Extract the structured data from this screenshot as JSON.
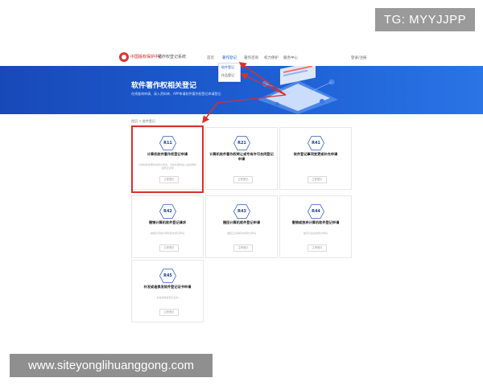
{
  "watermark": {
    "tg": "TG: MYYJJPP",
    "site": "www.siteyonglihuanggong.com"
  },
  "header": {
    "logo_text": "中国版权保护中心",
    "logo_sub": "著作权登记系统",
    "nav": [
      "首页",
      "著作登记",
      "著作咨询",
      "权力保护",
      "服务中心"
    ],
    "active_nav_index": 1,
    "login": "登录/注册",
    "dropdown": [
      "软件登记",
      "作品登记"
    ]
  },
  "hero": {
    "title": "软件著作权相关登记",
    "subtitle": "在线查询申请、录入资料单、APP申请软件著作权登记申请登记"
  },
  "breadcrumb": "首页 > 软件登记",
  "cards": [
    {
      "code": "R11",
      "title": "计算机软件著作权登记申请",
      "desc": "计算机软件著作权登记申请、为软件著作权人提供著作权登记证明",
      "button": "立即登记"
    },
    {
      "code": "R21",
      "title": "计算机软件著作权转让或专有许可合同登记申请",
      "desc": "",
      "button": "立即登记"
    },
    {
      "code": "R41",
      "title": "软件登记事项变更或补充申请",
      "desc": "",
      "button": "立即登记"
    },
    {
      "code": "R42",
      "title": "撤销计算机软件登记请求",
      "desc": "撤销已有的计算机软件登记申请",
      "button": "立即登记"
    },
    {
      "code": "R43",
      "title": "撤回计算机软件登记申请",
      "desc": "撤回正在审核中的登记申请",
      "button": "立即登记"
    },
    {
      "code": "R44",
      "title": "撤销或放弃计算机软件登记申请",
      "desc": "放弃已提交的登记申请",
      "button": "立即登记"
    },
    {
      "code": "R45",
      "title": "补发或者换发软件登记证书申请",
      "desc": "补发或换发登记证书",
      "button": "立即登记"
    }
  ],
  "colors": {
    "hero": "#1d5fd3",
    "highlight": "#d9302d",
    "hex_border": "#2a5fc1"
  }
}
